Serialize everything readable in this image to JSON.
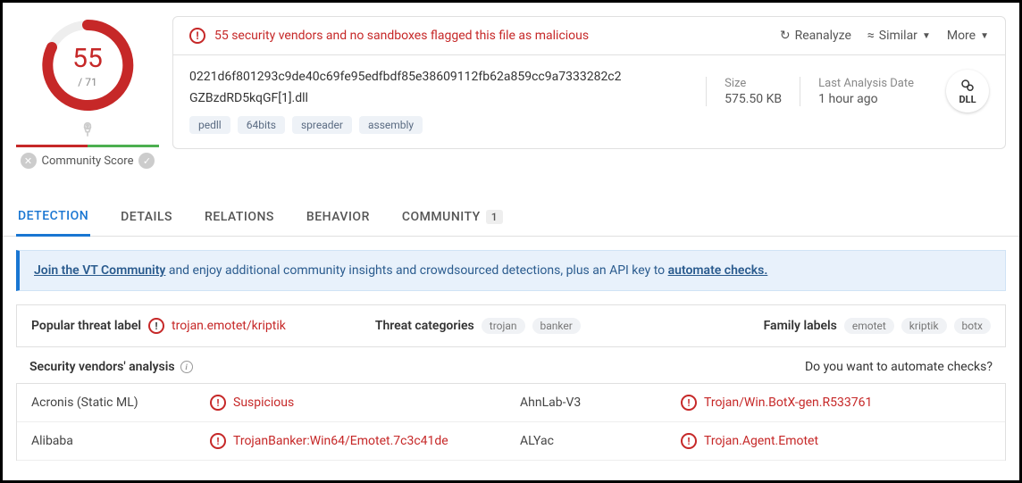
{
  "gauge": {
    "score": "55",
    "total": "/ 71"
  },
  "community": {
    "label": "Community Score"
  },
  "alert": {
    "text": "55 security vendors and no sandboxes flagged this file as malicious"
  },
  "actions": {
    "reanalyze": "Reanalyze",
    "similar": "Similar",
    "more": "More"
  },
  "file": {
    "hash": "0221d6f801293c9de40c69fe95edfbdf85e38609112fb62a859cc9a7333282c2",
    "name": "GZBzdRD5kqGF[1].dll",
    "tags": [
      "pedll",
      "64bits",
      "spreader",
      "assembly"
    ]
  },
  "meta": {
    "size_label": "Size",
    "size_value": "575.50 KB",
    "date_label": "Last Analysis Date",
    "date_value": "1 hour ago",
    "type_icon": "DLL"
  },
  "tabs": [
    {
      "label": "DETECTION",
      "active": true
    },
    {
      "label": "DETAILS"
    },
    {
      "label": "RELATIONS"
    },
    {
      "label": "BEHAVIOR"
    },
    {
      "label": "COMMUNITY",
      "badge": "1"
    }
  ],
  "banner": {
    "link1": "Join the VT Community",
    "mid": " and enjoy additional community insights and crowdsourced detections, plus an API key to ",
    "link2": "automate checks."
  },
  "summary": {
    "threat_label_title": "Popular threat label",
    "threat_label_value": "trojan.emotet/kriptik",
    "categories_title": "Threat categories",
    "categories": [
      "trojan",
      "banker"
    ],
    "families_title": "Family labels",
    "families": [
      "emotet",
      "kriptik",
      "botx"
    ]
  },
  "vendors_header": {
    "left": "Security vendors' analysis",
    "right": "Do you want to automate checks?"
  },
  "vendors": [
    {
      "name1": "Acronis (Static ML)",
      "det1": "Suspicious",
      "name2": "AhnLab-V3",
      "det2": "Trojan/Win.BotX-gen.R533761"
    },
    {
      "name1": "Alibaba",
      "det1": "TrojanBanker:Win64/Emotet.7c3c41de",
      "name2": "ALYac",
      "det2": "Trojan.Agent.Emotet"
    }
  ]
}
